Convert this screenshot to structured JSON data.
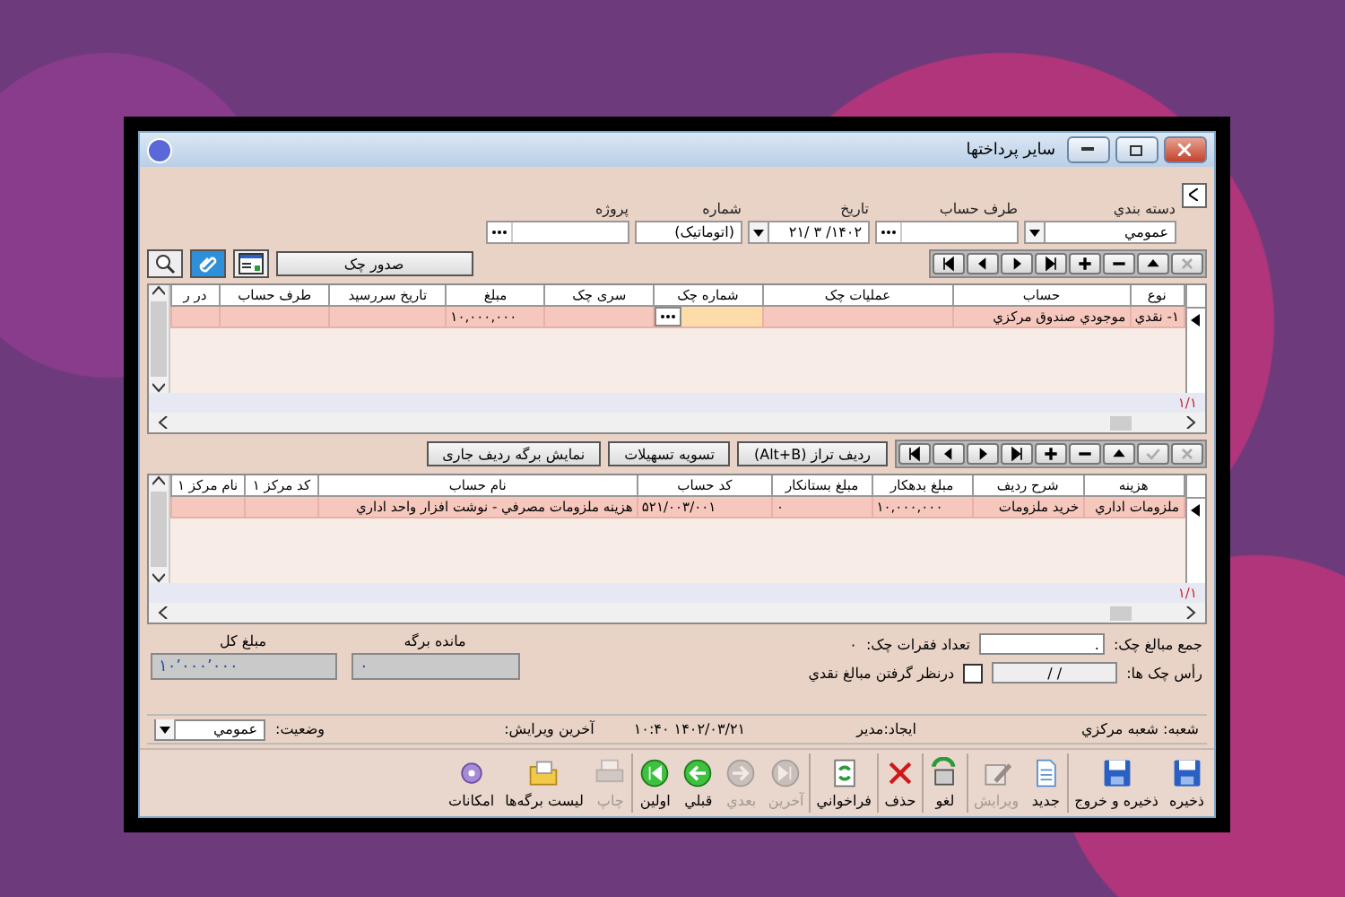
{
  "window": {
    "title": "سایر پرداختها"
  },
  "header": {
    "fields": [
      {
        "label": "دسته بندي",
        "kind": "select",
        "value": "عمومي"
      },
      {
        "label": "طرف حساب",
        "kind": "lookup"
      },
      {
        "label": "تاریخ",
        "kind": "date",
        "value": "۱۴۰۲/ ۳ /۲۱"
      },
      {
        "label": "شماره",
        "kind": "text",
        "value": "(اتوماتیک)"
      },
      {
        "label": "پروژه",
        "kind": "lookup"
      }
    ]
  },
  "checks_toolbar": {
    "nav": [
      {
        "kind": "cancel",
        "disabled": true
      },
      {
        "kind": "up",
        "disabled": false
      },
      {
        "kind": "minus",
        "disabled": false
      },
      {
        "kind": "plus",
        "disabled": false
      },
      {
        "kind": "last",
        "disabled": false
      },
      {
        "kind": "next",
        "disabled": false
      },
      {
        "kind": "prev",
        "disabled": false
      },
      {
        "kind": "first",
        "disabled": false
      }
    ],
    "actions": [
      {
        "kind": "text",
        "label": "صدور چک"
      },
      {
        "kind": "grid"
      },
      {
        "kind": "clip"
      },
      {
        "kind": "zoom"
      }
    ]
  },
  "checks_table": {
    "columns": [
      "نوع",
      "حساب",
      "عملیات چک",
      "شماره چک",
      "سری چک",
      "مبلغ",
      "تاریخ سررسید",
      "طرف حساب",
      "در ر"
    ],
    "rows": [
      {
        "cells": [
          {
            "text": "۱- نقدي",
            "focused": false
          },
          {
            "text": "موجودي صندوق مرکزي",
            "focused": false
          },
          {
            "text": "",
            "focused": false
          },
          {
            "text": "",
            "focused": true
          },
          {
            "text": "",
            "focused": false
          },
          {
            "text": "۱۰,۰۰۰,۰۰۰",
            "focused": false
          },
          {
            "text": "",
            "focused": false
          },
          {
            "text": "",
            "focused": false
          },
          {
            "text": "",
            "focused": false
          }
        ]
      }
    ],
    "counter": "۱/۱"
  },
  "items_toolbar": {
    "nav": [
      {
        "kind": "cancel",
        "disabled": true
      },
      {
        "kind": "check",
        "disabled": true
      },
      {
        "kind": "up",
        "disabled": false
      },
      {
        "kind": "minus",
        "disabled": false
      },
      {
        "kind": "plus",
        "disabled": false
      },
      {
        "kind": "last",
        "disabled": false
      },
      {
        "kind": "next",
        "disabled": false
      },
      {
        "kind": "prev",
        "disabled": false
      },
      {
        "kind": "first",
        "disabled": false
      }
    ],
    "buttons": [
      "ردیف تراز (Alt+B)",
      "تسویه تسهیلات",
      "نمایش برگه ردیف جاری"
    ]
  },
  "items_table": {
    "columns": [
      "هزینه",
      "شرح ردیف",
      "مبلغ بدهکار",
      "مبلغ بستانکار",
      "کد حساب",
      "نام حساب",
      "کد مرکز ۱",
      "نام مرکز ۱"
    ],
    "rows": [
      {
        "cells": [
          "ملزومات اداري",
          "خرید ملزومات",
          "۱۰,۰۰۰,۰۰۰",
          "۰",
          "۵۲۱/۰۰۳/۰۰۱",
          "هزینه ملزومات مصرفي - نوشت افزار  واحد اداري",
          "",
          ""
        ]
      }
    ],
    "counter": "۱/۱"
  },
  "summary": {
    "check_total_label": "جمع مبالغ چک:",
    "check_total_value": ".",
    "check_count_label": "تعداد فقرات چک:",
    "check_count_value": "۰",
    "due_label": "رأس چک ها:",
    "due_value": "/   /",
    "cash_checkbox": {
      "label": "درنظر گرفتن مبالغ نقدي",
      "checked": false
    },
    "balance_label": "مانده برگه",
    "balance_value": "۰",
    "total_label": "مبلغ کل",
    "total_value": "۱۰٬۰۰۰٬۰۰۰"
  },
  "status_bar": {
    "branch": "شعبه: شعبه مرکزي",
    "created": "ایجاد:مدیر",
    "timestamp": "۱۴۰۲/۰۳/۲۱ ۱۰:۴۰",
    "last_edit": "آخرین ویرایش:",
    "status_label": "وضعیت:",
    "status_value": "عمومي"
  },
  "bottom_toolbar": [
    {
      "kind": "save",
      "label": "ذخیره",
      "disabled": false
    },
    {
      "kind": "save",
      "label": "ذخیره و خروج",
      "disabled": false
    },
    {
      "kind": "new",
      "label": "جدید",
      "disabled": false
    },
    {
      "kind": "edit",
      "label": "ویرایش",
      "disabled": true
    },
    {
      "kind": "undo",
      "label": "لغو",
      "disabled": false
    },
    {
      "kind": "delete",
      "label": "حذف",
      "disabled": false
    },
    {
      "kind": "refresh",
      "label": "فراخواني",
      "disabled": false
    },
    {
      "kind": "last",
      "label": "آخرین",
      "disabled": true
    },
    {
      "kind": "next",
      "label": "بعدي",
      "disabled": true
    },
    {
      "kind": "prev",
      "label": "قبلي",
      "disabled": false
    },
    {
      "kind": "first",
      "label": "اولین",
      "disabled": false
    },
    {
      "kind": "print",
      "label": "چاپ",
      "disabled": true
    },
    {
      "kind": "folder",
      "label": "لیست برگه‌ها",
      "disabled": false
    },
    {
      "kind": "tools",
      "label": "امکانات",
      "disabled": false
    }
  ]
}
